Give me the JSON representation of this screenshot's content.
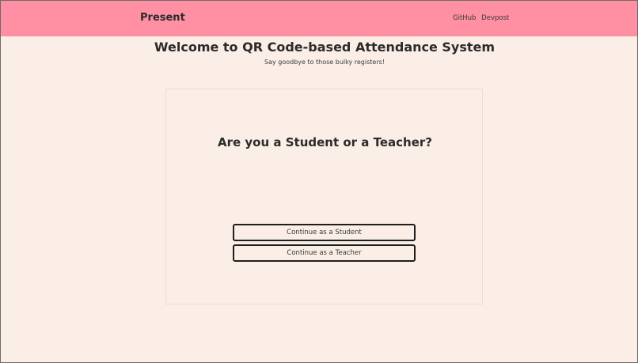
{
  "navbar": {
    "brand": "Present",
    "links": [
      "GitHub",
      "Devpost"
    ]
  },
  "hero": {
    "title": "Welcome to QR Code-based Attendance System",
    "subtitle": "Say goodbye to those bulky registers!"
  },
  "role_card": {
    "question": "Are you a Student or a Teacher?",
    "buttons": [
      "Continue as a Student",
      "Continue as a Teacher"
    ]
  },
  "colors": {
    "navbar_bg": "#ff8fa3",
    "page_bg": "#fbeee6",
    "text": "#2b2b2b",
    "button_border": "#1e1e1e"
  }
}
